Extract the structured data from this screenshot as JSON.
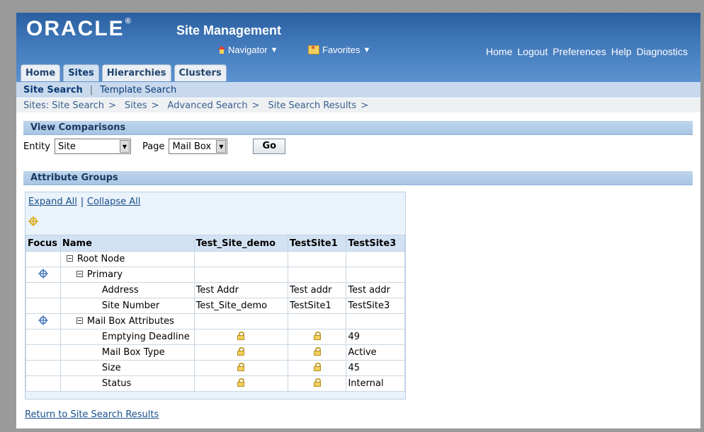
{
  "brand": {
    "logo": "ORACLE",
    "app_title": "Site Management"
  },
  "header": {
    "navigator_label": "Navigator",
    "favorites_label": "Favorites",
    "global_links": [
      "Home",
      "Logout",
      "Preferences",
      "Help",
      "Diagnostics"
    ]
  },
  "tabs": [
    {
      "label": "Home",
      "active": false
    },
    {
      "label": "Sites",
      "active": true
    },
    {
      "label": "Hierarchies",
      "active": false
    },
    {
      "label": "Clusters",
      "active": false
    }
  ],
  "subnav": {
    "current": "Site Search",
    "other": "Template Search"
  },
  "breadcrumbs": [
    "Sites: Site Search",
    "Sites",
    "Advanced Search",
    "Site Search Results"
  ],
  "view_comparisons": {
    "title": "View Comparisons",
    "entity_label": "Entity",
    "entity_value": "Site",
    "page_label": "Page",
    "page_value": "Mail Box",
    "go_label": "Go"
  },
  "attribute_groups": {
    "title": "Attribute Groups",
    "expand_all": "Expand All",
    "collapse_all": "Collapse All",
    "columns": [
      "Focus",
      "Name",
      "Test_Site_demo",
      "TestSite1",
      "TestSite3"
    ],
    "rows": [
      {
        "name": "Root Node",
        "level": 0,
        "expander": true,
        "focus": false,
        "values": [
          "",
          "",
          ""
        ]
      },
      {
        "name": "Primary",
        "level": 1,
        "expander": true,
        "focus": true,
        "values": [
          "",
          "",
          ""
        ]
      },
      {
        "name": "Address",
        "level": 2,
        "expander": false,
        "focus": false,
        "values": [
          "Test Addr",
          "Test addr",
          "Test addr"
        ]
      },
      {
        "name": "Site Number",
        "level": 2,
        "expander": false,
        "focus": false,
        "values": [
          "Test_Site_demo",
          "TestSite1",
          "TestSite3"
        ]
      },
      {
        "name": "Mail Box Attributes",
        "level": 1,
        "expander": true,
        "focus": true,
        "values": [
          "",
          "",
          ""
        ]
      },
      {
        "name": "Emptying Deadline",
        "level": 2,
        "expander": false,
        "focus": false,
        "values": [
          "lock",
          "lock",
          "49"
        ]
      },
      {
        "name": "Mail Box Type",
        "level": 2,
        "expander": false,
        "focus": false,
        "values": [
          "lock",
          "lock",
          "Active"
        ]
      },
      {
        "name": "Size",
        "level": 2,
        "expander": false,
        "focus": false,
        "values": [
          "lock",
          "lock",
          "45"
        ]
      },
      {
        "name": "Status",
        "level": 2,
        "expander": false,
        "focus": false,
        "values": [
          "lock",
          "lock",
          "Internal"
        ]
      }
    ]
  },
  "return_link": "Return to Site Search Results",
  "icons": {
    "lock": "lock-icon",
    "focus": "crosshair-focus-icon",
    "navigator": "home-icon",
    "favorites": "favorites-folder-icon"
  }
}
